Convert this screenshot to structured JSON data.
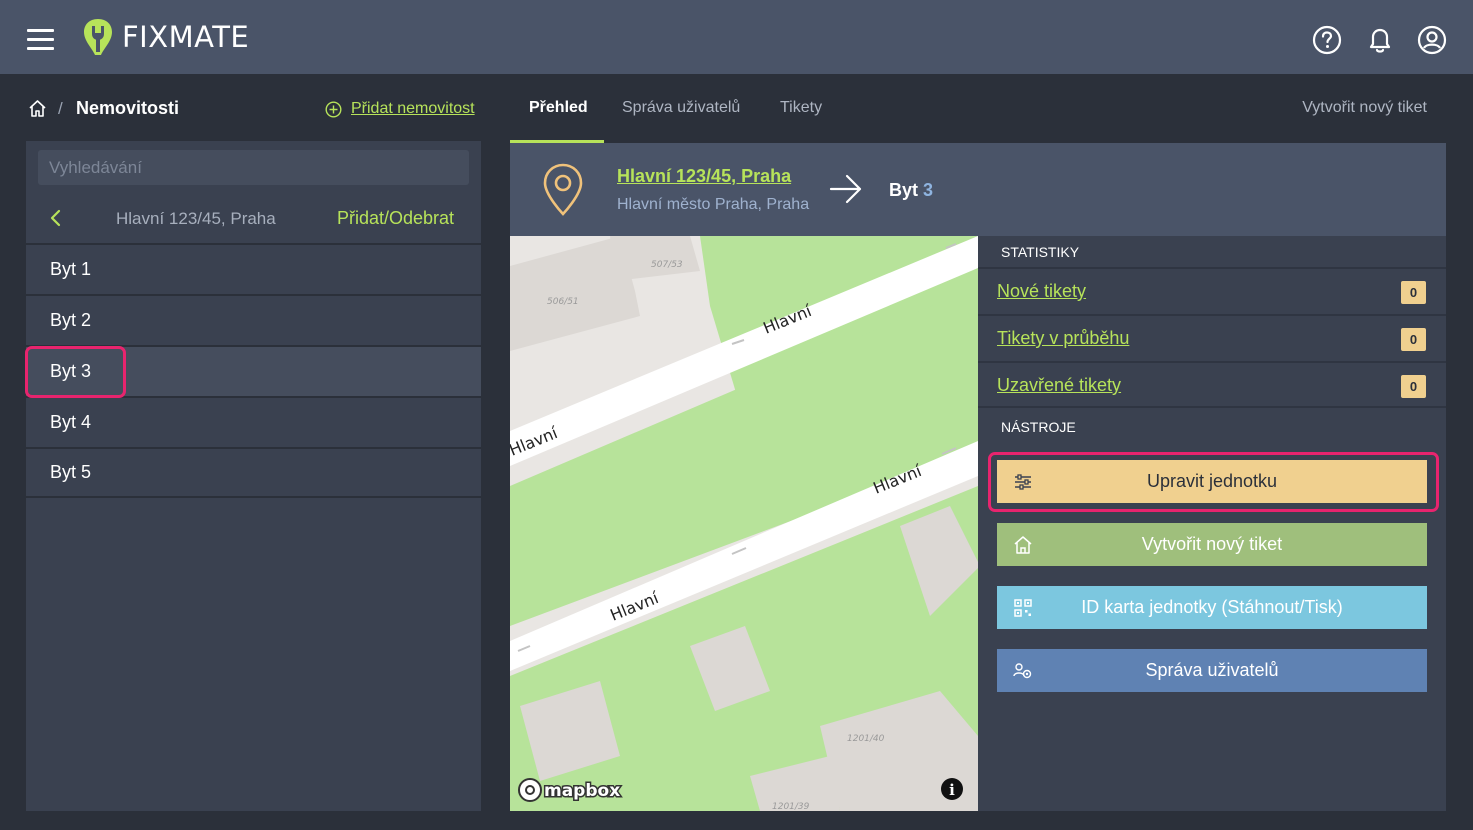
{
  "topbar": {
    "logo_text": "FIXMATE",
    "brand_color": "#b7e35a",
    "icons": [
      "menu-icon",
      "help-icon",
      "bell-icon",
      "user-icon"
    ]
  },
  "breadcrumb": {
    "separator": "/",
    "current": "Nemovitosti",
    "add_property": "Přidat nemovitost"
  },
  "tabs": [
    {
      "label": "Přehled",
      "active": true
    },
    {
      "label": "Správa uživatelů",
      "active": false
    },
    {
      "label": "Tikety",
      "active": false
    }
  ],
  "new_ticket_link": "Vytvořit nový tiket",
  "left_panel": {
    "search_placeholder": "Vyhledávání",
    "address": "Hlavní 123/45, Praha",
    "add_remove": "Přidat/Odebrat",
    "units": [
      {
        "label": "Byt 1",
        "selected": false
      },
      {
        "label": "Byt 2",
        "selected": false
      },
      {
        "label": "Byt 3",
        "selected": true
      },
      {
        "label": "Byt 4",
        "selected": false
      },
      {
        "label": "Byt 5",
        "selected": false
      }
    ]
  },
  "header": {
    "address": "Hlavní 123/45, Praha",
    "city": "Hlavní město Praha, Praha",
    "unit_prefix": "Byt",
    "unit_number": "3"
  },
  "map": {
    "street_labels": [
      "Hlavní",
      "Hlavní",
      "Hlavní",
      "Hlavní"
    ],
    "house_numbers": [
      "507/53",
      "506/51",
      "1201/40",
      "1201/39"
    ],
    "attribution": "mapbox",
    "info": "i"
  },
  "stats": {
    "heading": "STATISTIKY",
    "rows": [
      {
        "label": "Nové tikety",
        "count": "0"
      },
      {
        "label": "Tikety v průběhu",
        "count": "0"
      },
      {
        "label": "Uzavřené tikety",
        "count": "0"
      }
    ]
  },
  "tools": {
    "heading": "NÁSTROJE",
    "edit_unit": "Upravit jednotku",
    "new_ticket": "Vytvořit nový tiket",
    "id_card": "ID karta jednotky (Stáhnout/Tisk)",
    "user_mgmt": "Správa uživatelů"
  }
}
